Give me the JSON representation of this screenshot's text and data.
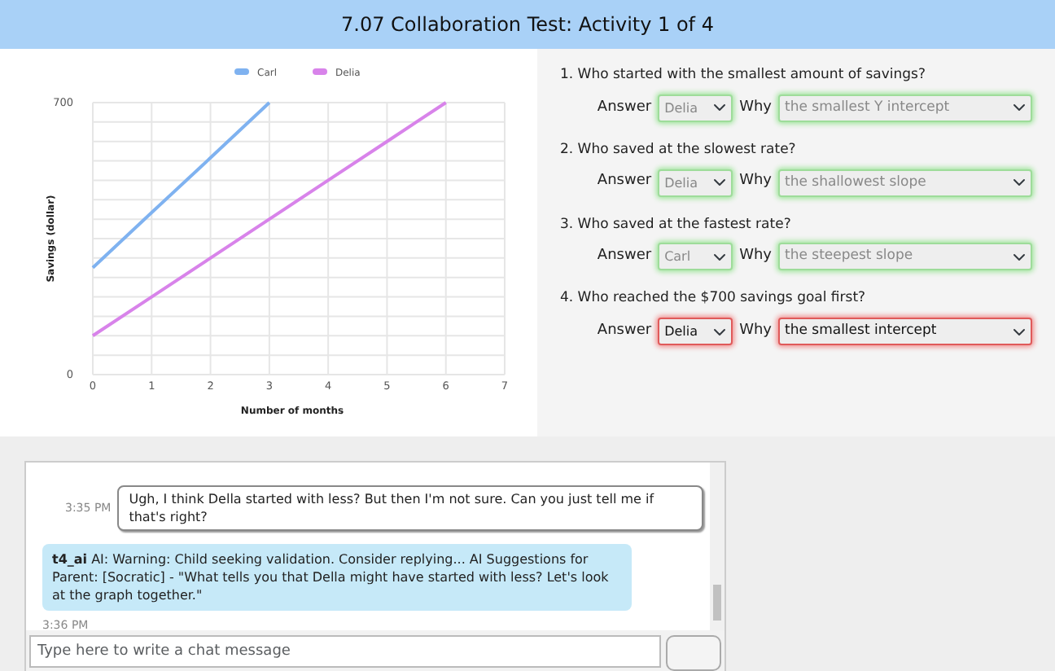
{
  "window": {
    "title": "7.07 Collaboration Test: Activity 1 of 4"
  },
  "chart": {
    "chart_data": {
      "type": "line",
      "xlabel": "Number of months",
      "ylabel": "Savings (dollar)",
      "x": [
        0,
        1,
        2,
        3,
        4,
        5,
        6
      ],
      "series": [
        {
          "name": "Carl",
          "color": "#7fb2f0",
          "values": [
            275,
            417,
            558,
            700,
            null,
            null,
            null
          ]
        },
        {
          "name": "Delia",
          "color": "#d883ea",
          "values": [
            100,
            200,
            300,
            400,
            500,
            600,
            700
          ]
        }
      ],
      "grid": true,
      "legend": true,
      "xlim": [
        0,
        7
      ],
      "ylim": [
        0,
        700
      ],
      "xticks": [
        0,
        1,
        2,
        3,
        4,
        5,
        6,
        7
      ],
      "yticks": [
        0,
        700
      ]
    }
  },
  "questions": [
    {
      "text": "1. Who started with the smallest amount of savings?",
      "answer_label": "Answer",
      "answer": "Delia",
      "why_label": "Why",
      "why": "the smallest Y intercept",
      "correct": true
    },
    {
      "text": "2. Who saved at the slowest rate?",
      "answer_label": "Answer",
      "answer": "Delia",
      "why_label": "Why",
      "why": "the shallowest slope",
      "correct": true
    },
    {
      "text": "3. Who saved at the fastest rate?",
      "answer_label": "Answer",
      "answer": "Carl",
      "why_label": "Why",
      "why": "the steepest slope",
      "correct": true
    },
    {
      "text": "4. Who reached the $700 savings goal first?",
      "answer_label": "Answer",
      "answer": "Delia",
      "why_label": "Why",
      "why": "the smallest intercept",
      "correct": false
    }
  ],
  "chat": {
    "messages": [
      {
        "kind": "user",
        "time": "3:35 PM",
        "text": "Ugh, I think Della started with less? But then I'm not sure. Can you just tell me if that's right?"
      },
      {
        "kind": "ai",
        "sender": "t4_ai",
        "text": "AI: Warning: Child seeking validation. Consider replying... AI Suggestions for Parent: [Socratic] - \"What tells you that Della might have started with less? Let's look at the graph together.\"",
        "time": "3:36 PM"
      }
    ],
    "input": {
      "placeholder": "Type here to write a chat message"
    }
  }
}
